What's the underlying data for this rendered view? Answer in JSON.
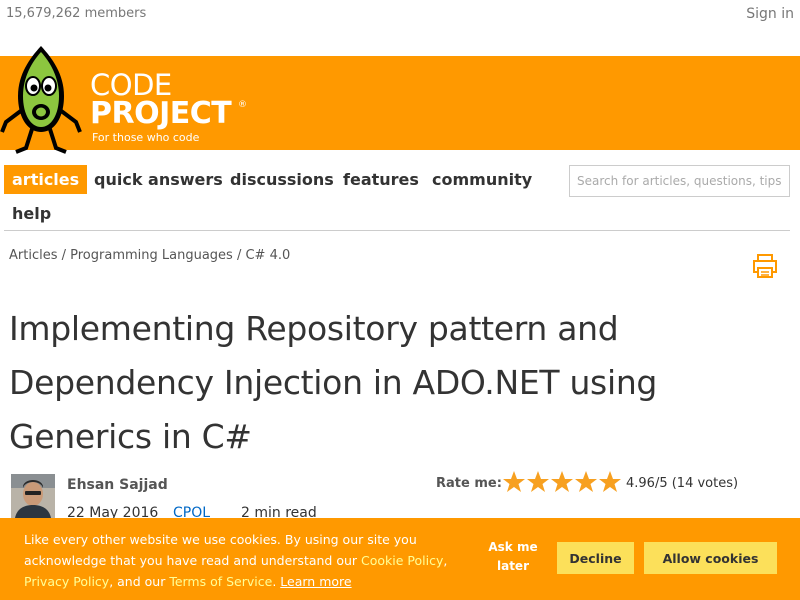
{
  "header": {
    "member_count": "15,679,262 members",
    "sign_in": "Sign in"
  },
  "logo": {
    "line1": "CODE",
    "line2": "PROJECT",
    "registered": "®",
    "tagline": "For those who code"
  },
  "nav": {
    "items": [
      {
        "label": "articles",
        "active": true
      },
      {
        "label": "quick answers",
        "active": false
      },
      {
        "label": "discussions",
        "active": false
      },
      {
        "label": "features",
        "active": false
      },
      {
        "label": "community",
        "active": false
      },
      {
        "label": "help",
        "active": false
      }
    ],
    "search_placeholder": "Search for articles, questions, tips"
  },
  "breadcrumb": {
    "items": [
      "Articles",
      "Programming Languages",
      "C# 4.0"
    ],
    "separator": " / "
  },
  "article": {
    "title": "Implementing Repository pattern and Dependency Injection in ADO.NET using Generics in C#",
    "author": "Ehsan Sajjad",
    "date": "22 May 2016",
    "license": "CPOL",
    "read_time": "2 min read"
  },
  "rating": {
    "label": "Rate me:",
    "stars_max": 5,
    "score_text": "4.96/5 (14 votes)"
  },
  "cookie": {
    "text_before": "Like every other website we use cookies. By using our site you acknowledge that you have read and understand our ",
    "cookie_policy": "Cookie Policy",
    "comma": ", ",
    "privacy_policy": "Privacy Policy",
    "text_mid": ", and our ",
    "terms": "Terms of Service",
    "period": ". ",
    "learn_more": "Learn more",
    "ask_later": "Ask me later",
    "decline": "Decline",
    "allow": "Allow cookies"
  },
  "colors": {
    "brand_orange": "#ff9900",
    "button_yellow": "#fce05a",
    "link_blue": "#0068c6",
    "star": "#f7a020"
  }
}
